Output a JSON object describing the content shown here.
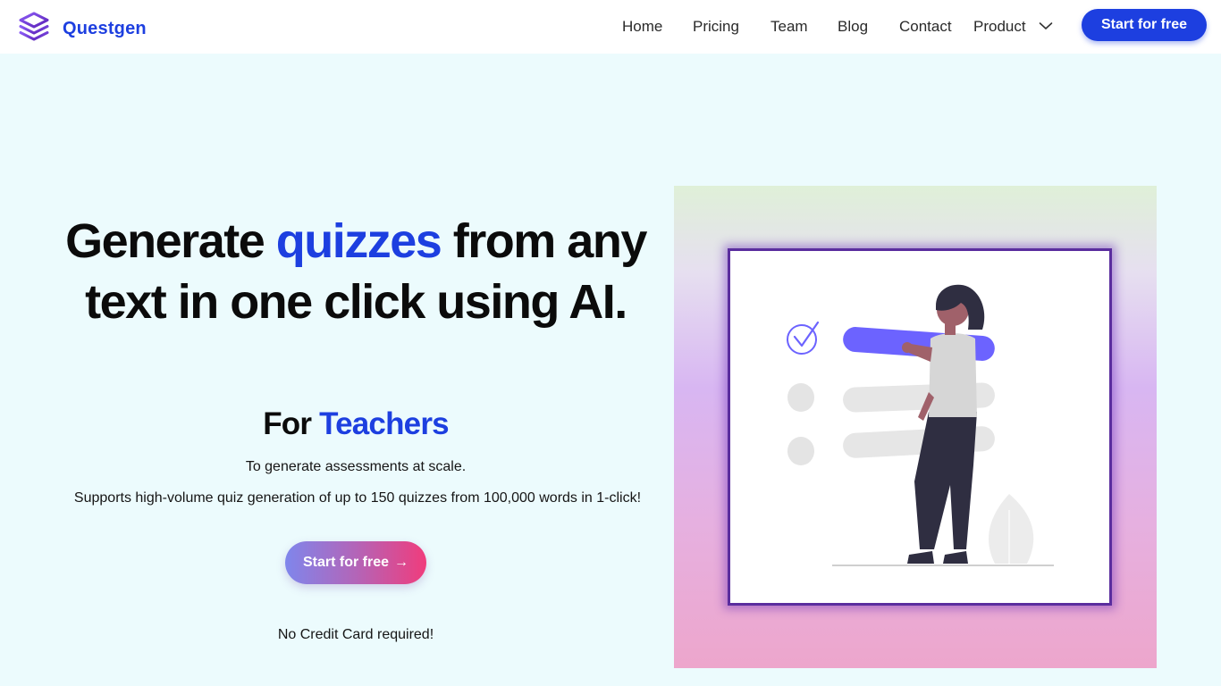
{
  "header": {
    "brand_name": "Questgen",
    "logo_icon": "layers-logo-icon",
    "nav": [
      "Home",
      "Pricing",
      "Team",
      "Blog",
      "Contact"
    ],
    "product_label": "Product",
    "product_icon": "chevron-down-icon",
    "cta_label": "Start for free"
  },
  "hero": {
    "headline": {
      "part1": "Generate ",
      "accent": "quizzes",
      "part2": " from any text in one click using AI."
    },
    "subhead": {
      "prefix": "For ",
      "accent": "Teachers"
    },
    "description_1": "To generate assessments at scale.",
    "description_2": "Supports high-volume quiz generation of up to 150 quizzes from 100,000 words in 1-click!",
    "cta_label": "Start for free",
    "cta_arrow": "→",
    "note": "No Credit Card required!"
  },
  "illustration": {
    "description_icon": "woman-checklist-illustration"
  },
  "colors": {
    "brand": "#1d3fe0",
    "page_bg": "#ecfbfd",
    "logo": "#7c3aed",
    "illustration_accent": "#6c63ff"
  }
}
